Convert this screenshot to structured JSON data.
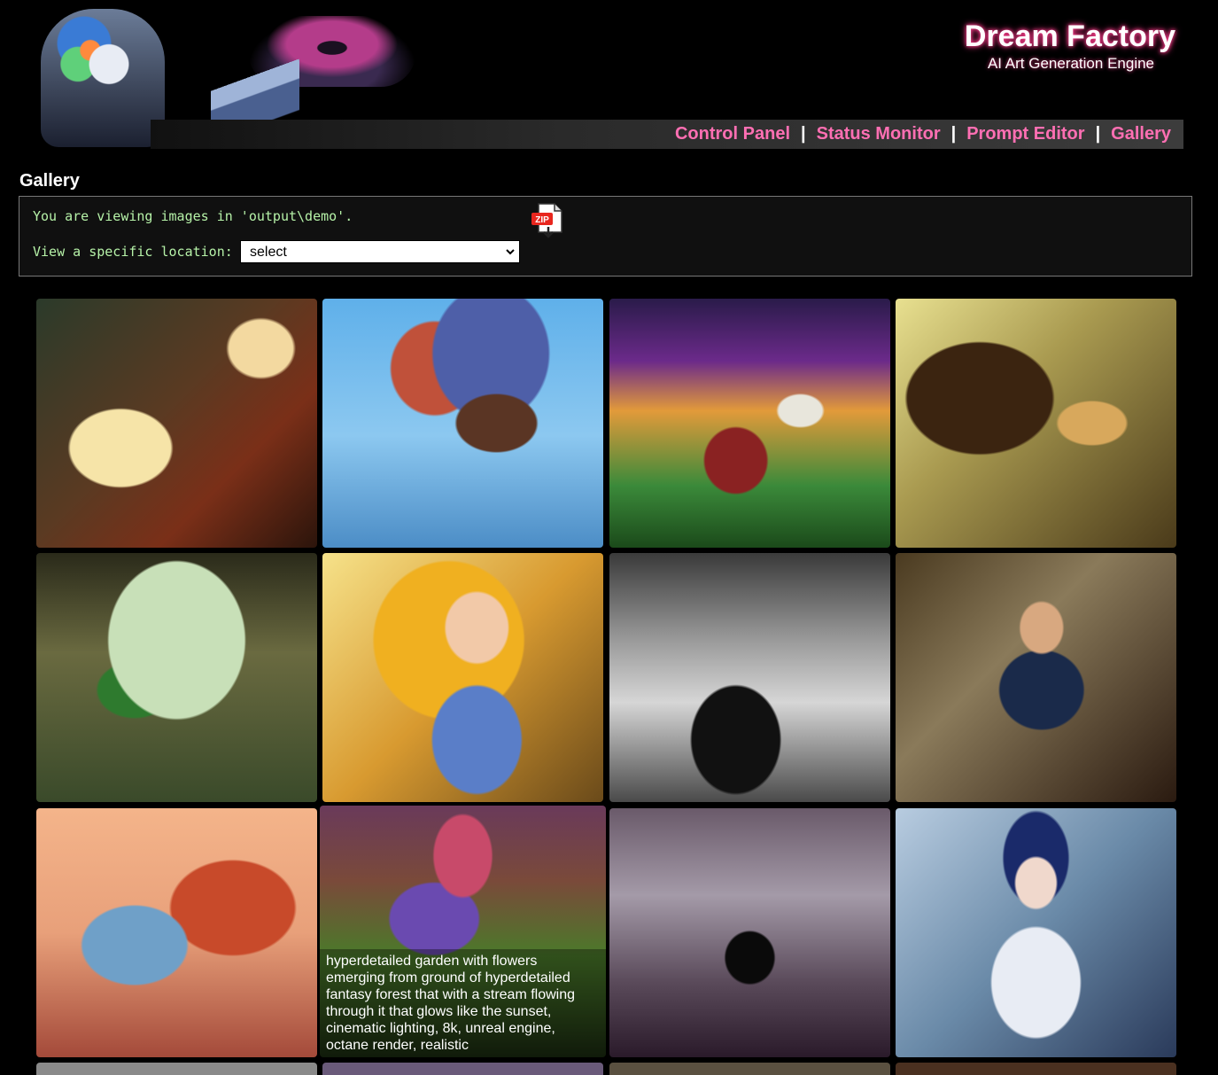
{
  "brand": {
    "title": "Dream Factory",
    "subtitle": "AI Art Generation Engine"
  },
  "nav": {
    "items": [
      {
        "label": "Control Panel"
      },
      {
        "label": "Status Monitor"
      },
      {
        "label": "Prompt Editor"
      },
      {
        "label": "Gallery"
      }
    ],
    "separator": "|"
  },
  "page": {
    "section_title": "Gallery"
  },
  "info": {
    "viewing_text": "You are viewing images in 'output\\demo'.",
    "location_label": "View a specific location:",
    "location_select": {
      "selected": "select"
    },
    "zip_icon": "zip-download-icon",
    "zip_label": "ZIP"
  },
  "colors": {
    "nav_link": "#ff6fb3",
    "info_text": "#b6f2a8",
    "title_glow": "#ff3c8c"
  },
  "gallery": {
    "images": [
      {
        "id": "hamster-piano-1"
      },
      {
        "id": "feather-woman"
      },
      {
        "id": "lighthouse"
      },
      {
        "id": "hamster-piano-2"
      },
      {
        "id": "fantasy-castle"
      },
      {
        "id": "cartoon-elf-girl"
      },
      {
        "id": "steam-train"
      },
      {
        "id": "mustache-man"
      },
      {
        "id": "coral-woman"
      },
      {
        "id": "garden",
        "caption": "hyperdetailed garden with flowers emerging from ground of hyperdetailed fantasy forest that with a stream flowing through it that glows like the sunset, cinematic lighting, 8k, unreal engine, octane render, realistic"
      },
      {
        "id": "catwoman"
      },
      {
        "id": "fairy-snow-white"
      }
    ]
  }
}
